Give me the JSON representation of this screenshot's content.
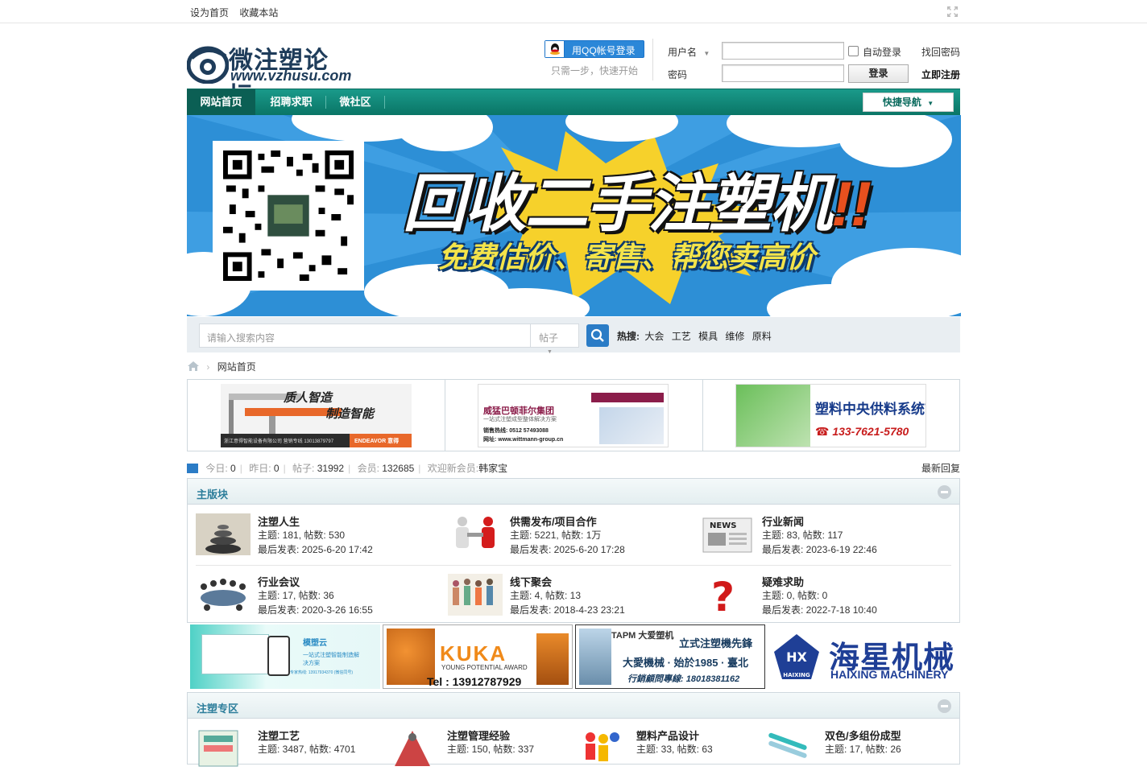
{
  "topbar": {
    "set_home": "设为首页",
    "bookmark": "收藏本站"
  },
  "header": {
    "logo_cn": "微注塑论坛",
    "logo_en": "www.vzhusu.com",
    "qq_login": "用QQ帐号登录",
    "qq_hint": "只需一步，快速开始",
    "username_label": "用户名",
    "password_label": "密码",
    "auto_login": "自动登录",
    "forgot": "找回密码",
    "login_button": "登录",
    "register": "立即注册"
  },
  "nav": {
    "items": [
      "网站首页",
      "招聘求职",
      "微社区"
    ],
    "quick_nav": "快捷导航"
  },
  "banner": {
    "title": "回收二手注塑机",
    "exclaim": "!!",
    "subtitle": "免费估价、寄售、帮您卖高价"
  },
  "search": {
    "placeholder": "请输入搜索内容",
    "type": "帖子",
    "hot_label": "热搜:",
    "hot_terms": [
      "大会",
      "工艺",
      "模具",
      "维修",
      "原料"
    ]
  },
  "breadcrumb": {
    "current": "网站首页"
  },
  "ads_top": [
    {
      "line1": "质人智造",
      "line2": "制造智能",
      "footer": "浙江意得智能设备有限公司  营销专线 13013879797",
      "brand": "ENDEAVOR 意得"
    },
    {
      "brand": "威猛巴顿菲尔集团",
      "tagline": "一站式注塑成型整体解决方案",
      "phone": "销售热线: 0512 57493088",
      "site": "网址: www.wittmann-group.cn"
    },
    {
      "title": "塑料中央供料系统首选",
      "phone": "133-7621-5780"
    }
  ],
  "stats": {
    "today_label": "今日:",
    "today": "0",
    "yesterday_label": "昨日:",
    "yesterday": "0",
    "posts_label": "帖子:",
    "posts": "31992",
    "members_label": "会员:",
    "members": "132685",
    "welcome_label": "欢迎新会员:",
    "newest_member": "韩家宝",
    "latest_reply": "最新回复"
  },
  "section_main": {
    "title": "主版块",
    "forums": [
      {
        "name": "注塑人生",
        "stats": "主题: 181, 帖数: 530",
        "last": "最后发表: 2025-6-20 17:42"
      },
      {
        "name": "供需发布/项目合作",
        "stats": "主题: 5221, 帖数: 1万",
        "last": "最后发表: 2025-6-20 17:28"
      },
      {
        "name": "行业新闻",
        "stats": "主题: 83, 帖数: 117",
        "last": "最后发表: 2023-6-19 22:46"
      },
      {
        "name": "行业会议",
        "stats": "主题: 17, 帖数: 36",
        "last": "最后发表: 2020-3-26 16:55"
      },
      {
        "name": "线下聚会",
        "stats": "主题: 4, 帖数: 13",
        "last": "最后发表: 2018-4-23 23:21"
      },
      {
        "name": "疑难求助",
        "stats": "主题: 0, 帖数: 0",
        "last": "最后发表: 2022-7-18 10:40"
      }
    ]
  },
  "ads_mid": [
    {
      "brand": "模塑云",
      "text": "一站式注塑智能制造解决方案",
      "phone": "专家热线: 13917934370 (微信同号)"
    },
    {
      "brand": "KUKA",
      "award": "YOUNG POTENTIAL AWARD",
      "phone": "Tel : 13912787929"
    },
    {
      "brand": "TAPM 大爱塑机",
      "title": "立式注塑機先鋒",
      "sub": "大愛機械 · 始於1985 · 臺北",
      "phone": "行銷顧問專線: 18018381162"
    },
    {
      "brand_cn": "海星机械",
      "brand_en": "HAIXING MACHINERY",
      "logo_text": "HAIXING"
    }
  ],
  "section_zone": {
    "title": "注塑专区",
    "forums": [
      {
        "name": "注塑工艺",
        "stats": "主题: 3487, 帖数: 4701"
      },
      {
        "name": "注塑管理经验",
        "stats": "主题: 150, 帖数: 337"
      },
      {
        "name": "塑料产品设计",
        "stats": "主题: 33, 帖数: 63"
      },
      {
        "name": "双色/多组份成型",
        "stats": "主题: 17, 帖数: 26"
      }
    ]
  },
  "colors": {
    "nav": "#0f8677",
    "banner_blue": "#2d8fd6",
    "link_blue": "#2b7cc6",
    "section_title": "#2d7e9b"
  }
}
